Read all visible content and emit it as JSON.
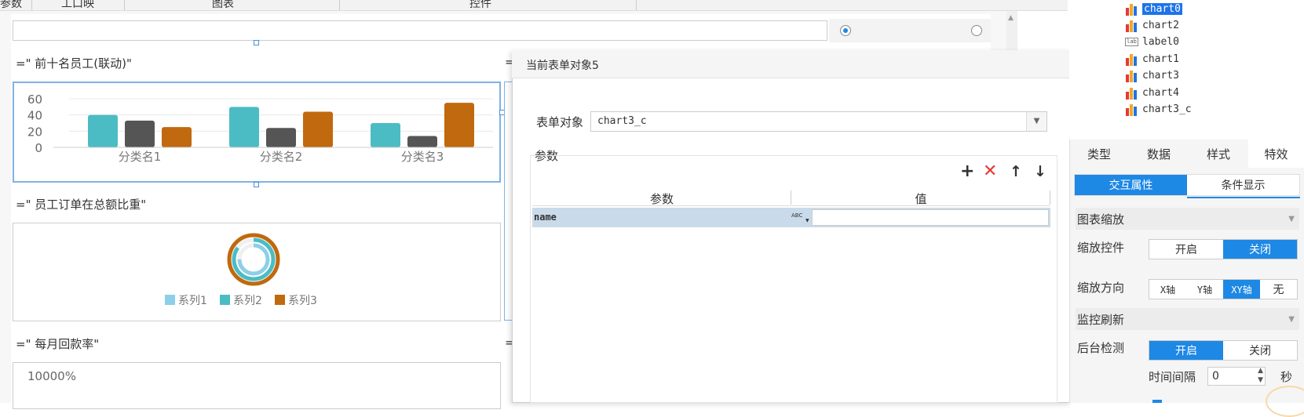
{
  "topbar": {
    "item1": "参数",
    "item2": "工口映",
    "item3": "图表",
    "item4": "控件"
  },
  "canvas": {
    "radio_selected": "●",
    "widgets": {
      "w1_title": "=\"   前十名员工(联动)\"",
      "w2_title": "=\"   员工订单在总额比重\"",
      "w3_title": "=\"   每月回款率\"",
      "w3_ytick": "10000%",
      "eq1": "=",
      "eq2": "=",
      "eq3": "="
    }
  },
  "chart_data": [
    {
      "type": "bar",
      "categories": [
        "分类名1",
        "分类名2",
        "分类名3"
      ],
      "series": [
        {
          "name": "系列1",
          "values": [
            40,
            50,
            30
          ]
        },
        {
          "name": "系列2",
          "values": [
            33,
            24,
            14
          ]
        },
        {
          "name": "系列3",
          "values": [
            25,
            44,
            55
          ]
        }
      ],
      "yticks": [
        "0",
        "20",
        "40",
        "60"
      ],
      "ylim": [
        0,
        60
      ],
      "colors": [
        "#4bbcc4",
        "#555555",
        "#c0690e"
      ],
      "grid": true
    },
    {
      "type": "pie",
      "series": [
        {
          "name": "系列1",
          "values": [
            0.75
          ],
          "color": "#8ccfe8"
        },
        {
          "name": "系列2",
          "values": [
            0.85
          ],
          "color": "#4bbcc4"
        },
        {
          "name": "系列3",
          "values": [
            1.0
          ],
          "color": "#c0690e"
        }
      ],
      "legend": [
        "系列1",
        "系列2",
        "系列3"
      ],
      "legend_placement": "bottom"
    }
  ],
  "tree": {
    "items": [
      "chart0",
      "chart2",
      "label0",
      "chart1",
      "chart3",
      "chart4",
      "chart3_c"
    ],
    "label_icon_text": "lab"
  },
  "props": {
    "tabs": [
      "类型",
      "数据",
      "样式",
      "特效"
    ],
    "subtabs": [
      "交互属性",
      "条件显示"
    ],
    "section_zoom": "图表缩放",
    "zoom_control_label": "缩放控件",
    "zoom_control_opts": [
      "开启",
      "关闭"
    ],
    "zoom_dir_label": "缩放方向",
    "zoom_dir_opts": [
      "X轴",
      "Y轴",
      "XY轴",
      "无"
    ],
    "section_monitor": "监控刷新",
    "bg_check_label": "后台检测",
    "bg_check_opts": [
      "开启",
      "关闭"
    ],
    "interval_label": "时间间隔",
    "interval_value": "0",
    "interval_unit": "秒",
    "collapse_arrow": "▼"
  },
  "dialog": {
    "title": "当前表单对象5",
    "form_obj_label": "表单对象",
    "form_obj_value": "chart3_c",
    "params_label": "参数",
    "table_headers": [
      "参数",
      "值"
    ],
    "rows": [
      {
        "param": "name",
        "value": ""
      }
    ],
    "value_type_icon": "ABC"
  },
  "colors": {
    "accent": "#1e88e5",
    "selected_tree": "#1e73e8",
    "row_highlight": "#c9dbea",
    "delete": "#e53935"
  }
}
